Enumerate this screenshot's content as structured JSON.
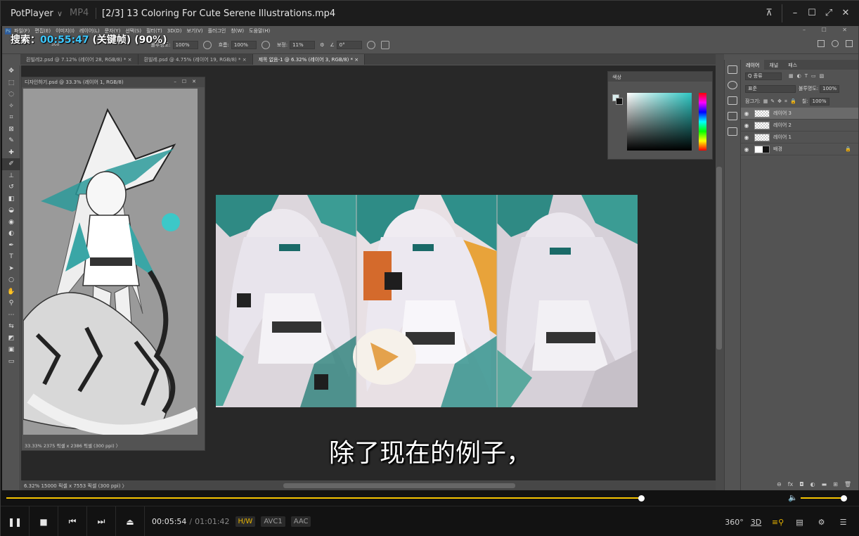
{
  "player": {
    "brand": "PotPlayer",
    "brand_chevron": "∨",
    "format": "MP4",
    "file_title": "[2/3] 13 Coloring For Cute Serene Illustrations.mp4",
    "window_buttons": [
      "pin-icon",
      "minimize-icon",
      "maximize-icon",
      "fullscreen-icon",
      "close-icon"
    ]
  },
  "overlay": {
    "search_label": "搜索：",
    "search_time": "00:55:47",
    "search_rest": "(关键帧) (90%)"
  },
  "photoshop": {
    "menu": [
      "파일(F)",
      "편집(E)",
      "이미지(I)",
      "레이어(L)",
      "문자(Y)",
      "선택(S)",
      "필터(T)",
      "3D(D)",
      "보기(V)",
      "플러그인",
      "창(W)",
      "도움말(H)"
    ],
    "options": {
      "size": "500",
      "opacity_label": "불투명도:",
      "opacity_value": "100%",
      "flow_label": "흐름:",
      "flow_value": "100%",
      "smoothing_label": "보정:",
      "smoothing_value": "11%",
      "angle_value": "0°"
    },
    "tabs": [
      {
        "label": "흰빌레2.psd @ 7.12% (레이어 28, RGB/8) *  ×",
        "active": false
      },
      {
        "label": "흰빌레.psd @ 4.75% (레이어 19, RGB/8) *  ×",
        "active": false
      },
      {
        "label": "제목 없음-1 @ 6.32% (레이어 3, RGB/8) *  ×",
        "active": true
      }
    ],
    "float_doc": {
      "title": "디자인하기.psd @ 33.3% (레이어 1, RGB/8)",
      "status": "33.33%    2375 픽셀 x 2386 픽셀 (300 ppi)   〉"
    },
    "color_panel_title": "색상",
    "layers_panel": {
      "tabs": [
        "레이어",
        "채널",
        "패스"
      ],
      "kind_filter": "Q 종류",
      "blend_mode": "표준",
      "opacity_label": "불투명도:",
      "opacity_value": "100%",
      "lock_label": "잠그기:",
      "fill_label": "칠:",
      "fill_value": "100%",
      "layers": [
        {
          "name": "레이어 3",
          "selected": true,
          "background": false
        },
        {
          "name": "레이어 2",
          "selected": false,
          "background": false
        },
        {
          "name": "레이어 1",
          "selected": false,
          "background": false
        },
        {
          "name": "배경",
          "selected": false,
          "background": true
        }
      ]
    },
    "status": "6.32%    15000 픽셀 x 7553 픽셀 (300 ppi)   〉"
  },
  "subtitle": "除了现在的例子，",
  "playback": {
    "seek_progress": 0.818,
    "volume_level": 0.92,
    "current_time": "00:05:54",
    "separator": "/",
    "total_time": "01:01:42",
    "badges": [
      "H/W",
      "AVC1",
      "AAC"
    ],
    "right_controls": [
      "360°",
      "3D"
    ]
  },
  "colors": {
    "accent": "#f5c400",
    "overlay_highlight": "#3ec8ff",
    "ps_panel": "#535353",
    "ps_canvas_bg": "#282828"
  }
}
